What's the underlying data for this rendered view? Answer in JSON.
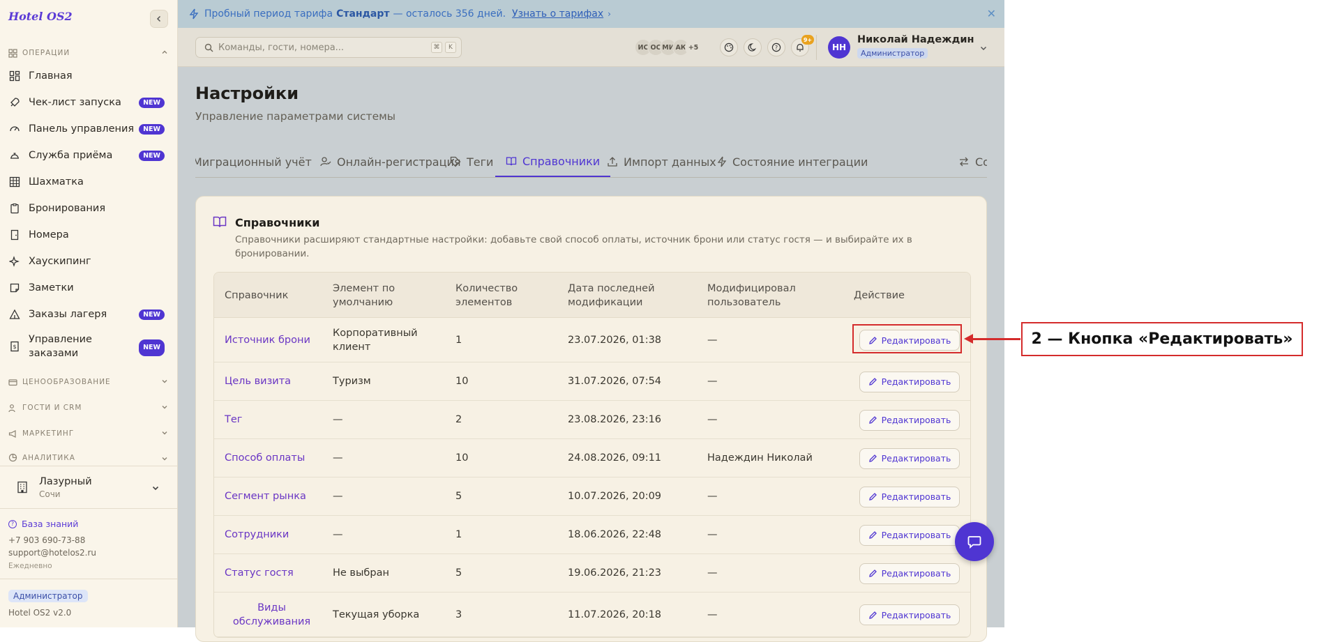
{
  "app": {
    "logo": "Hotel OS2"
  },
  "sidebar": {
    "sections": [
      {
        "label": "ОПЕРАЦИИ"
      },
      {
        "label": "ЦЕНООБРАЗОВАНИЕ"
      },
      {
        "label": "ГОСТИ И CRM"
      },
      {
        "label": "МАРКЕТИНГ"
      },
      {
        "label": "АНАЛИТИКА"
      }
    ],
    "items": [
      {
        "label": "Главная",
        "icon": "layout-grid-icon"
      },
      {
        "label": "Чек-лист запуска",
        "icon": "rocket-icon",
        "badge": "NEW"
      },
      {
        "label": "Панель управления",
        "icon": "gauge-icon",
        "badge": "NEW"
      },
      {
        "label": "Служба приёма",
        "icon": "concierge-bell-icon",
        "badge": "NEW"
      },
      {
        "label": "Шахматка",
        "icon": "grid-table-icon"
      },
      {
        "label": "Бронирования",
        "icon": "clipboard-icon"
      },
      {
        "label": "Номера",
        "icon": "door-icon"
      },
      {
        "label": "Хаускипинг",
        "icon": "sparkles-icon"
      },
      {
        "label": "Заметки",
        "icon": "sticky-note-icon"
      },
      {
        "label": "Заказы лагеря",
        "icon": "tent-icon",
        "badge": "NEW"
      },
      {
        "label": "Управление заказами",
        "icon": "receipt-icon",
        "badge": "NEW"
      }
    ],
    "hotel": {
      "name": "Лазурный",
      "city": "Сочи"
    },
    "knowledge_base": "База знаний",
    "phone": "+7 903 690-73-88",
    "email": "support@hotelos2.ru",
    "hours": "Ежедневно",
    "role": "Администратор",
    "version": "Hotel OS2 v2.0"
  },
  "banner": {
    "prefix": "Пробный период тарифа",
    "plan": "Стандарт",
    "suffix": "— осталось 356 дней.",
    "link": "Узнать о тарифах",
    "close": "✕"
  },
  "topbar": {
    "search_placeholder": "Команды, гости, номера...",
    "kbd": [
      "⌘",
      "K"
    ],
    "avatars": [
      "ИС",
      "ОС",
      "МИ",
      "АК",
      "+5"
    ],
    "notif_count": "9+",
    "user": {
      "initials": "НН",
      "name": "Николай Надеждин",
      "role": "Администратор"
    }
  },
  "page": {
    "title": "Настройки",
    "subtitle": "Управление параметрами системы",
    "tabs": [
      {
        "label": "Миграционный учёт"
      },
      {
        "label": "Онлайн-регистрация"
      },
      {
        "label": "Теги"
      },
      {
        "label": "Справочники"
      },
      {
        "label": "Импорт данных"
      },
      {
        "label": "Состояние интеграции"
      },
      {
        "label": "Со"
      }
    ]
  },
  "card": {
    "title": "Справочники",
    "description": "Справочники расширяют стандартные настройки: добавьте свой способ оплаты, источник брони или статус гостя — и выбирайте их в бронировании."
  },
  "table": {
    "headers": [
      "Справочник",
      "Элемент по умолчанию",
      "Количество элементов",
      "Дата последней модификации",
      "Модифицировал пользователь",
      "Действие"
    ],
    "edit_label": "Редактировать",
    "rows": [
      {
        "name": "Источник брони",
        "default": "Корпоративный клиент",
        "count": "1",
        "date": "23.07.2026, 01:38",
        "user": "—"
      },
      {
        "name": "Цель визита",
        "default": "Туризм",
        "count": "10",
        "date": "31.07.2026, 07:54",
        "user": "—"
      },
      {
        "name": "Тег",
        "default": "—",
        "count": "2",
        "date": "23.08.2026, 23:16",
        "user": "—"
      },
      {
        "name": "Способ оплаты",
        "default": "—",
        "count": "10",
        "date": "24.08.2026, 09:11",
        "user": "Надеждин Николай"
      },
      {
        "name": "Сегмент рынка",
        "default": "—",
        "count": "5",
        "date": "10.07.2026, 20:09",
        "user": "—"
      },
      {
        "name": "Сотрудники",
        "default": "—",
        "count": "1",
        "date": "18.06.2026, 22:48",
        "user": "—"
      },
      {
        "name": "Статус гостя",
        "default": "Не выбран",
        "count": "5",
        "date": "19.06.2026, 21:23",
        "user": "—"
      },
      {
        "name": "Виды обслуживания",
        "default": "Текущая уборка",
        "count": "3",
        "date": "11.07.2026, 20:18",
        "user": "—"
      }
    ]
  },
  "annotation": {
    "label": "2 — Кнопка «Редактировать»",
    "color": "#d42b2b"
  },
  "colors": {
    "accent": "#4f35d2",
    "sidebar_bg": "#faf5ea",
    "banner_bg": "#b9cbd3"
  }
}
